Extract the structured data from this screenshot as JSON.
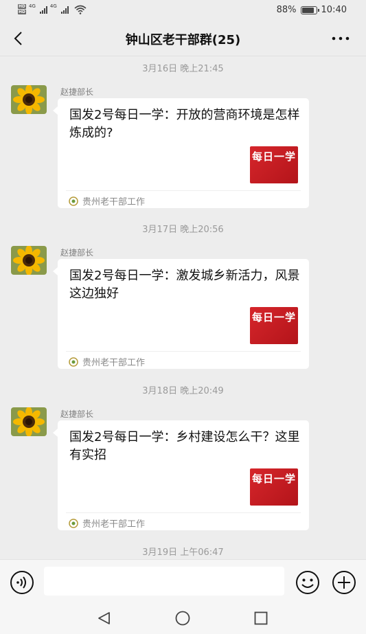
{
  "status_bar": {
    "network_badges": [
      "HD",
      "HD"
    ],
    "signal_labels": [
      "4G",
      "4G"
    ],
    "battery_text": "88%",
    "battery_level": 0.88,
    "time": "10:40"
  },
  "header": {
    "title": "钟山区老干部群(25)",
    "back_icon": "back-chevron-icon",
    "more_icon": "more-dots-icon"
  },
  "messages": [
    {
      "timestamp": "3月16日 晚上21:45",
      "sender": "赵捷部长",
      "title": "国发2号每日一学：开放的营商环境是怎样炼成的?",
      "thumb_text": "每日一学",
      "source": "贵州老干部工作"
    },
    {
      "timestamp": "3月17日 晚上20:56",
      "sender": "赵捷部长",
      "title": "国发2号每日一学：激发城乡新活力，风景这边独好",
      "thumb_text": "每日一学",
      "source": "贵州老干部工作"
    },
    {
      "timestamp": "3月18日 晚上20:49",
      "sender": "赵捷部长",
      "title": "国发2号每日一学：乡村建设怎么干？这里有实招",
      "thumb_text": "每日一学",
      "source": "贵州老干部工作"
    }
  ],
  "last_timestamp": "3月19日 上午06:47",
  "input_bar": {
    "value": "",
    "voice_icon": "voice-icon",
    "emoji_icon": "emoji-icon",
    "plus_icon": "plus-icon"
  },
  "colors": {
    "background": "#ededed",
    "card": "#ffffff",
    "thumb_red": "#c8191f",
    "timestamp_gray": "#9a9a9a"
  }
}
